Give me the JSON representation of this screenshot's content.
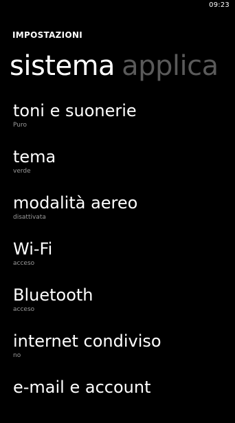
{
  "status_bar": {
    "time": "09:23"
  },
  "app_title": "IMPOSTAZIONI",
  "pivot": {
    "active": "sistema",
    "next": "applica"
  },
  "settings": [
    {
      "title": "toni e suonerie",
      "subtitle": "Puro"
    },
    {
      "title": "tema",
      "subtitle": "verde"
    },
    {
      "title": "modalità aereo",
      "subtitle": "disattivata"
    },
    {
      "title": "Wi-Fi",
      "subtitle": "acceso"
    },
    {
      "title": "Bluetooth",
      "subtitle": "acceso"
    },
    {
      "title": "internet condiviso",
      "subtitle": "no"
    },
    {
      "title": "e-mail e account",
      "subtitle": ""
    }
  ]
}
